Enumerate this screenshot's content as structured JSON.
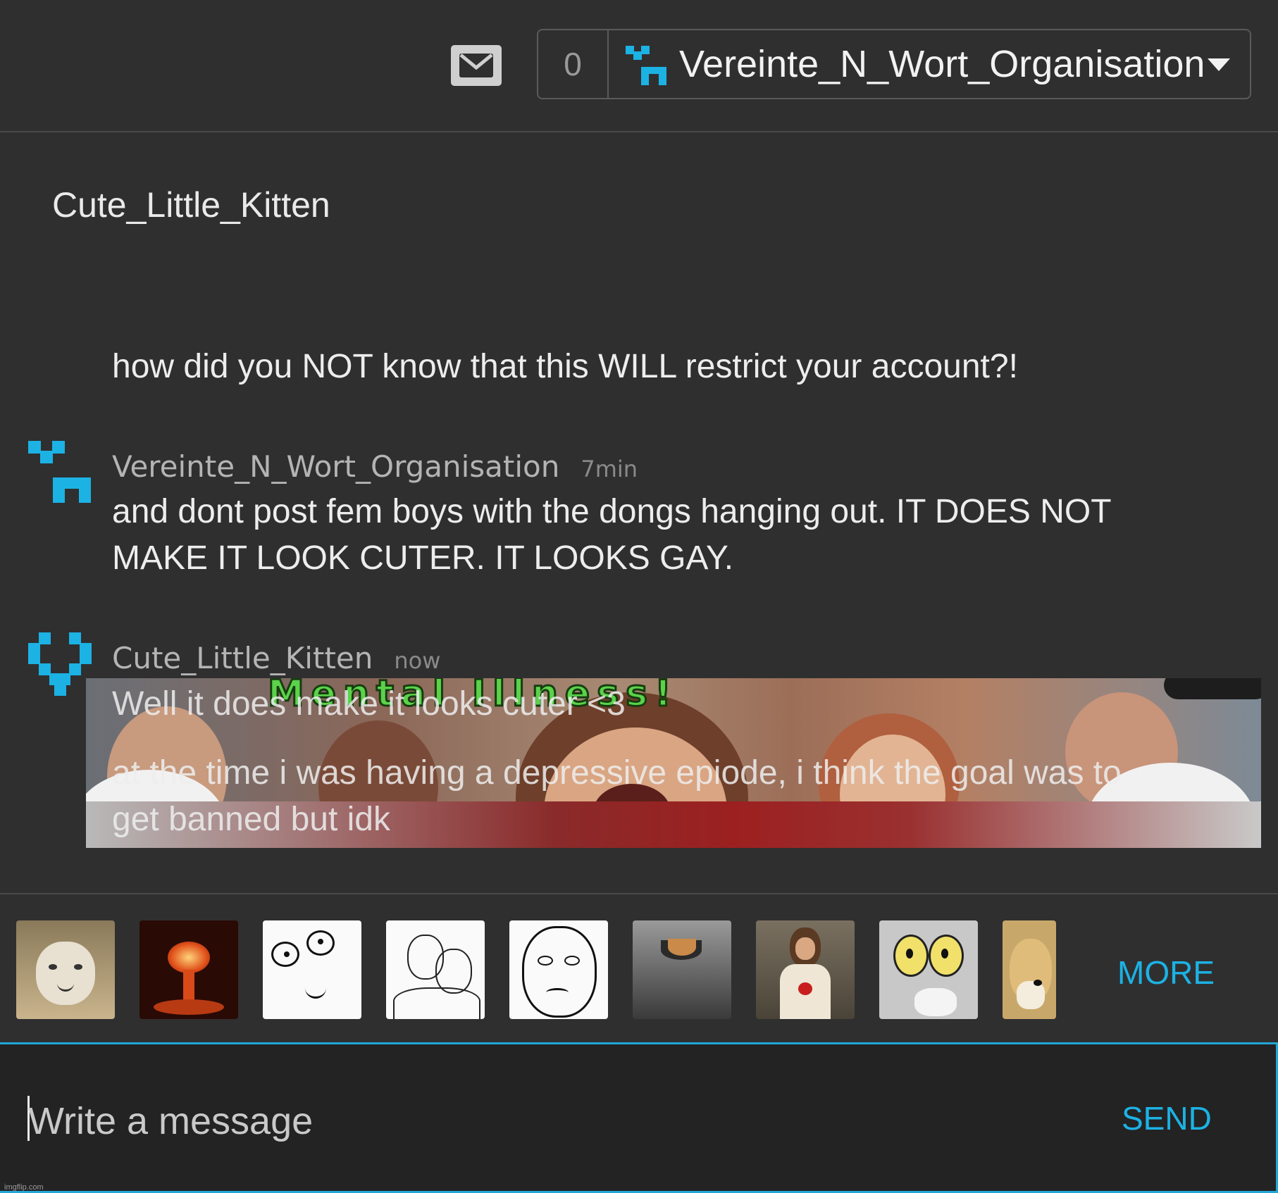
{
  "header": {
    "notification_count": "0",
    "account_name": "Vereinte_N_Wort_Organisation",
    "accent_color": "#1cb2e4"
  },
  "conversation": {
    "partner_name": "Cute_Little_Kitten",
    "messages": [
      {
        "author": "",
        "time": "",
        "text": "how did you NOT know that this WILL restrict your account?!"
      },
      {
        "author": "Vereinte_N_Wort_Organisation",
        "time": "7min",
        "lines": [
          "and dont post fem boys with the dongs hanging out. IT DOES NOT",
          "MAKE IT LOOK CUTER. IT LOOKS GAY."
        ]
      },
      {
        "author": "Cute_Little_Kitten",
        "time": "now",
        "lines": [
          "Well it does make it looks cuter <3",
          "at the time i was having a depressive epiode, i think the goal was to",
          "get banned but idk"
        ]
      }
    ],
    "meme_title": "Mental Illness!"
  },
  "meme_strip": {
    "thumbnails": [
      "happy-cat",
      "nuclear-explosion",
      "derp-rage-face",
      "i-know-that-feel-bro",
      "okay-face",
      "ceiling-cat",
      "buddy-christ",
      "unsettled-tom",
      "doge"
    ],
    "more_label": "MORE"
  },
  "composer": {
    "placeholder": "Write a message",
    "send_label": "SEND"
  },
  "watermark": "imgflip.com"
}
